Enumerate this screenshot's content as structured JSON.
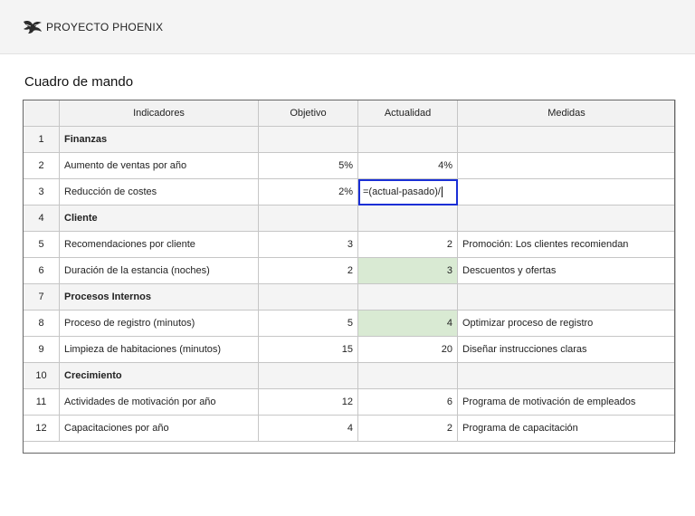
{
  "header": {
    "brand": "PROYECTO PHOENIX",
    "logo_icon": "phoenix-logo-icon"
  },
  "page_title": "Cuadro de mando",
  "columns": [
    "",
    "Indicadores",
    "Objetivo",
    "Actualidad",
    "Medidas"
  ],
  "rows": [
    {
      "n": "1",
      "indicator": "Finanzas",
      "target": "",
      "current": "",
      "measure": "",
      "section": true
    },
    {
      "n": "2",
      "indicator": "Aumento de ventas por año",
      "target": "5%",
      "current": "4%",
      "measure": ""
    },
    {
      "n": "3",
      "indicator": "Reducción de costes",
      "target": "2%",
      "current": "=(actual-pasado)/",
      "measure": "",
      "editing": true
    },
    {
      "n": "4",
      "indicator": "Cliente",
      "target": "",
      "current": "",
      "measure": "",
      "section": true
    },
    {
      "n": "5",
      "indicator": "Recomendaciones por cliente",
      "target": "3",
      "current": "2",
      "measure": "Promoción: Los clientes recomiendan"
    },
    {
      "n": "6",
      "indicator": "Duración de la estancia (noches)",
      "target": "2",
      "current": "3",
      "measure": "Descuentos y ofertas",
      "highlight": true
    },
    {
      "n": "7",
      "indicator": "Procesos Internos",
      "target": "",
      "current": "",
      "measure": "",
      "section": true
    },
    {
      "n": "8",
      "indicator": "Proceso de registro (minutos)",
      "target": "5",
      "current": "4",
      "measure": "Optimizar proceso de registro",
      "highlight": true
    },
    {
      "n": "9",
      "indicator": "Limpieza de habitaciones (minutos)",
      "target": "15",
      "current": "20",
      "measure": "Diseñar instrucciones claras"
    },
    {
      "n": "10",
      "indicator": "Crecimiento",
      "target": "",
      "current": "",
      "measure": "",
      "section": true
    },
    {
      "n": "11",
      "indicator": "Actividades de motivación por año",
      "target": "12",
      "current": "6",
      "measure": "Programa de motivación de empleados"
    },
    {
      "n": "12",
      "indicator": "Capacitaciones por año",
      "target": "4",
      "current": "2",
      "measure": "Programa de capacitación"
    }
  ],
  "colors": {
    "highlight": "#d9ead3",
    "active_cell_border": "#1a2fd6"
  }
}
